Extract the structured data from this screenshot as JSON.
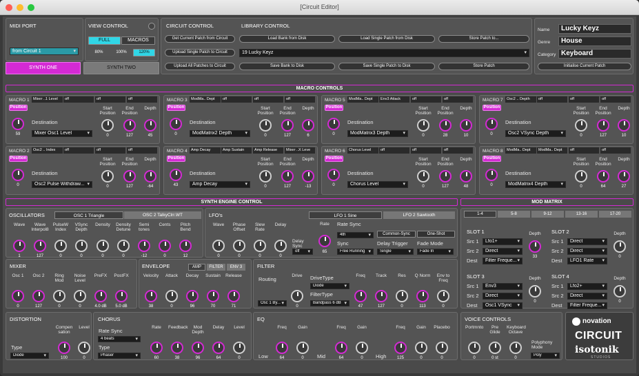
{
  "window": {
    "title": "[Circuit Editor]"
  },
  "midi_port": {
    "title": "MIDI PORT",
    "value": "from Circuit 1",
    "synth_one": "SYNTH ONE",
    "synth_two": "SYNTH TWO"
  },
  "view_control": {
    "title": "VIEW CONTROL",
    "full": "FULL",
    "macros": "MACROS",
    "zoom": [
      "80%",
      "100%",
      "120%"
    ]
  },
  "circuit_control": {
    "title": "CIRCUIT CONTROL",
    "buttons": [
      "Get Current Patch from Circuit",
      "Upload Single Patch to Circuit",
      "Upload All Patches to Circuit"
    ]
  },
  "library_control": {
    "title": "LIBRARY CONTROL",
    "load_bank": "Load Bank from Disk",
    "load_single": "Load Single Patch from Disk",
    "store_patch_to": "Store Patch to...",
    "patch_select": "19 Lucky Keyz",
    "save_bank": "Save Bank to Disk",
    "save_single": "Save Single Patch to Disk",
    "store_patch": "Store Patch"
  },
  "patch_info": {
    "name_label": "Name",
    "name": "Lucky Keyz",
    "genre_label": "Genre",
    "genre": "House",
    "category_label": "Category",
    "category": "Keyboard",
    "init": "Initialise Current Patch"
  },
  "macro_controls": {
    "title": "MACRO CONTROLS"
  },
  "common": {
    "position": "Position",
    "destination": "Destination",
    "start_position": "Start Position",
    "end_position": "End Position",
    "depth": "Depth",
    "off": "off"
  },
  "macros": [
    {
      "title": "MACRO 1",
      "slots": [
        "Mixer ..1 Level",
        "off",
        "off",
        "off"
      ],
      "pos": "59",
      "dest": "Mixer Osc1 Level",
      "start": "0",
      "end": "127",
      "depth": "45"
    },
    {
      "title": "MACRO 3",
      "slots": [
        "ModMa.. Dept",
        "off",
        "off",
        "off"
      ],
      "pos": "0",
      "dest": "ModMatrix2 Depth",
      "start": "0",
      "end": "127",
      "depth": "6"
    },
    {
      "title": "MACRO 5",
      "slots": [
        "ModMa.. Dept",
        "Env3 Attack",
        "off",
        "off"
      ],
      "pos": "0",
      "dest": "ModMatrix3 Depth",
      "start": "0",
      "end": "28",
      "depth": "10"
    },
    {
      "title": "MACRO 7",
      "slots": [
        "Osc2 .. Depth",
        "off",
        "off",
        "off"
      ],
      "pos": "0",
      "dest": "Osc2 VSync Depth",
      "start": "0",
      "end": "127",
      "depth": "10"
    },
    {
      "title": "MACRO 2",
      "slots": [
        "Osc2 .. Index",
        "off",
        "off",
        "off"
      ],
      "pos": "0",
      "dest": "Osc2 Pulse Withdraw...",
      "start": "0",
      "end": "127",
      "depth": "-64"
    },
    {
      "title": "MACRO 4",
      "slots": [
        "Amp Decay",
        "Amp Sustain",
        "Amp Release",
        "Mixer ..X Leve"
      ],
      "pos": "43",
      "dest": "Amp Decay",
      "start": "0",
      "end": "127",
      "depth": "-13"
    },
    {
      "title": "MACRO 6",
      "slots": [
        "Chorus Level",
        "off",
        "off",
        "off"
      ],
      "pos": "0",
      "dest": "Chorus Level",
      "start": "0",
      "end": "127",
      "depth": "48"
    },
    {
      "title": "MACRO 8",
      "slots": [
        "ModMa.. Dept",
        "ModMa.. Dept",
        "off",
        "off"
      ],
      "pos": "0",
      "dest": "ModMatrix4 Depth",
      "start": "0",
      "end": "64",
      "depth": "27"
    }
  ],
  "synth_engine": {
    "title": "SYNTH ENGINE CONTROL"
  },
  "oscillators": {
    "title": "OSCILLATORS",
    "tab1": "OSC 1 Triangle",
    "tab2": "OSC 2 TalkyClrr.WT",
    "knobs": [
      {
        "label": "Wave",
        "value": "1"
      },
      {
        "label": "Wave Interpol8",
        "value": "127"
      },
      {
        "label": "PulseW Index",
        "value": "0"
      },
      {
        "label": "VSync Depth",
        "value": "0"
      },
      {
        "label": "Density",
        "value": "0"
      },
      {
        "label": "Density Detune",
        "value": "0"
      },
      {
        "label": "Semi tones",
        "value": "-12"
      },
      {
        "label": "Cents",
        "value": "0"
      },
      {
        "label": "Pitch Bend",
        "value": "12"
      }
    ]
  },
  "lfos": {
    "title": "LFO's",
    "tab1": "LFO 1 Sine",
    "tab2": "LFO 2 Sawtooth",
    "knobs": [
      {
        "label": "Wave",
        "value": "0"
      },
      {
        "label": "Phase Offset",
        "value": "0"
      },
      {
        "label": "Slew Rate",
        "value": "0"
      },
      {
        "label": "Delay",
        "value": "0"
      }
    ],
    "delay_sync": "Delay Sync",
    "delay_sync_value": "off",
    "rate": "Rate",
    "rate_value": "65",
    "rate_sync": "Rate Sync",
    "rate_sync_value": "4th",
    "common_sync": "Common-Sync",
    "one_shot": "One-Shot",
    "sync": "Sync",
    "sync_value": "Free Running",
    "delay_trigger": "Delay Trigger",
    "delay_trigger_value": "Single",
    "fade_mode": "Fade Mode",
    "fade_mode_value": "Fade In"
  },
  "mixer": {
    "title": "MIXER",
    "knobs": [
      {
        "label": "Osc 1",
        "value": "0"
      },
      {
        "label": "Osc 2",
        "value": "127"
      },
      {
        "label": "Ring Mod",
        "value": "0"
      },
      {
        "label": "Noise Level",
        "value": "0"
      },
      {
        "label": "PreFX",
        "value": "4.0 dB"
      },
      {
        "label": "PostFX",
        "value": "5.0 dB"
      }
    ]
  },
  "envelope": {
    "title": "ENVELOPE",
    "tabs": [
      "AMP",
      "FILTER",
      "ENV 3"
    ],
    "knobs": [
      {
        "label": "Velocity",
        "value": "38"
      },
      {
        "label": "Attack",
        "value": "0"
      },
      {
        "label": "Decay",
        "value": "96"
      },
      {
        "label": "Sustain",
        "value": "70"
      },
      {
        "label": "Release",
        "value": "71"
      }
    ]
  },
  "filter": {
    "title": "FILTER",
    "routing": "Routing",
    "routing_value": "Osc 1 By...",
    "drive_type": "DriveType",
    "drive_type_value": "Diode",
    "filter_type": "FilterType",
    "filter_type_value": "Bandpass 6 dB",
    "knobs": [
      {
        "label": "Drive",
        "value": "0"
      },
      {
        "label": "Freq",
        "value": "47"
      },
      {
        "label": "Track",
        "value": "127"
      },
      {
        "label": "Res",
        "value": "0"
      },
      {
        "label": "Q Norm",
        "value": "113"
      },
      {
        "label": "Env to Freq",
        "value": "0"
      }
    ]
  },
  "distortion": {
    "title": "DISTORTION",
    "type": "Type",
    "type_value": "Diode",
    "knobs": [
      {
        "label": "Compen sation",
        "value": "100"
      },
      {
        "label": "Level",
        "value": "0"
      }
    ]
  },
  "chorus": {
    "title": "CHORUS",
    "rate_sync": "Rate Sync",
    "rate_sync_value": "4 beats",
    "type": "Type",
    "type_value": "Phaser",
    "knobs": [
      {
        "label": "Rate",
        "value": "60"
      },
      {
        "label": "Feedback",
        "value": "38"
      },
      {
        "label": "Mod Depth",
        "value": "96"
      },
      {
        "label": "Delay",
        "value": "64"
      },
      {
        "label": "Level",
        "value": "0"
      }
    ]
  },
  "eq": {
    "title": "EQ",
    "low": "Low",
    "mid": "Mid",
    "high": "High",
    "knobs": [
      {
        "label": "Freq",
        "value": "64"
      },
      {
        "label": "Gain",
        "value": "0"
      },
      {
        "label": "Freq",
        "value": "64"
      },
      {
        "label": "Gain",
        "value": "0"
      },
      {
        "label": "Freq",
        "value": "125"
      },
      {
        "label": "Gain",
        "value": "0"
      },
      {
        "label": "Placebo",
        "value": "0"
      }
    ]
  },
  "voice_controls": {
    "title": "VOICE CONTROLS",
    "polyphony": "Polyphony Mode",
    "polyphony_value": "Poly",
    "knobs": [
      {
        "label": "Portmnto",
        "value": "0"
      },
      {
        "label": "Pre Glide",
        "value": "0 st"
      },
      {
        "label": "Keyboard Octave",
        "value": "0"
      }
    ]
  },
  "mod_matrix": {
    "title": "MOD MATRIX",
    "tabs": [
      "1-4",
      "5-8",
      "9-12",
      "13-16",
      "17-20"
    ],
    "src1": "Src 1",
    "src2": "Src 2",
    "dest": "Dest",
    "depth": "Depth",
    "slots": [
      {
        "title": "SLOT 1",
        "src1": "Lfo1+",
        "src2": "Direct",
        "dest": "Filter Freque...",
        "depth": "33"
      },
      {
        "title": "SLOT 2",
        "src1": "Direct",
        "src2": "Direct",
        "dest": "LFO1 Rate",
        "depth": "0"
      },
      {
        "title": "SLOT 3",
        "src1": "Env3",
        "src2": "Direct",
        "dest": "Osc1 VSync",
        "depth": "0"
      },
      {
        "title": "SLOT 4",
        "src1": "Lfo2+",
        "src2": "Direct",
        "dest": "Filter Freque...",
        "depth": "0"
      }
    ]
  },
  "brand": {
    "novation": "novation",
    "circuit": "CIRCUIT",
    "isotonik": "isotonik",
    "studios": "STUDIOS"
  },
  "colors": {
    "accent": "#d42ad4",
    "cyan": "#30d6e6",
    "panel": "#545454"
  }
}
